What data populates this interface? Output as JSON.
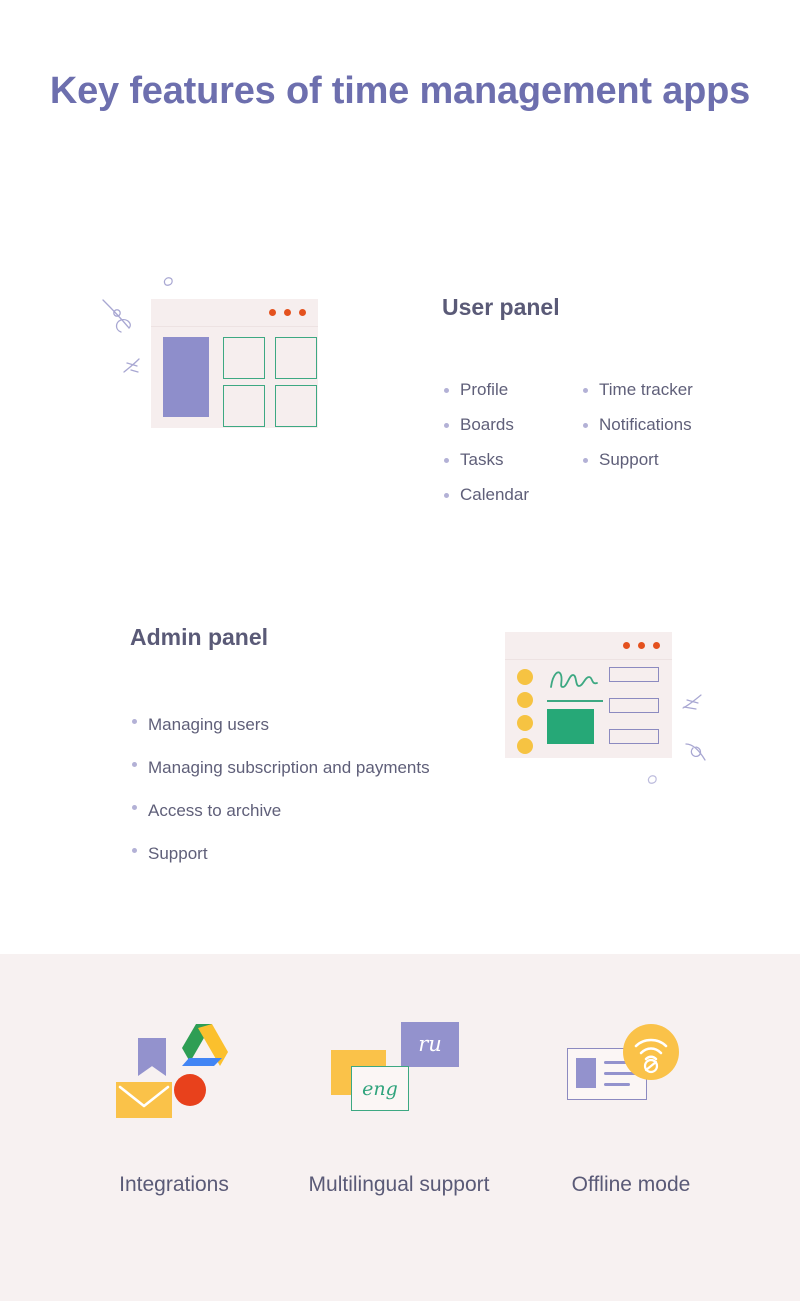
{
  "page": {
    "title": "Key features of time management apps",
    "background": "#ffffff",
    "band_background": "#f7f1f1",
    "accent_purple": "#6d6fae",
    "text_color": "#5f5f79",
    "green": "#3da882",
    "yellow": "#fac249",
    "orange_dot": "#e4511e",
    "lavender": "#9392cd"
  },
  "sections": {
    "user_panel": {
      "heading": "User panel",
      "column_1": [
        "Profile",
        "Boards",
        "Tasks",
        "Calendar"
      ],
      "column_2": [
        "Time tracker",
        "Notifications",
        "Support"
      ]
    },
    "admin_panel": {
      "heading": "Admin panel",
      "items": [
        "Managing users",
        "Managing subscription and payments",
        "Access to archive",
        "Support"
      ]
    }
  },
  "features": [
    {
      "label": "Integrations"
    },
    {
      "label": "Multilingual support"
    },
    {
      "label": "Offline mode"
    }
  ],
  "multilingual_cards": {
    "ru": "ru",
    "eng": "eng"
  }
}
